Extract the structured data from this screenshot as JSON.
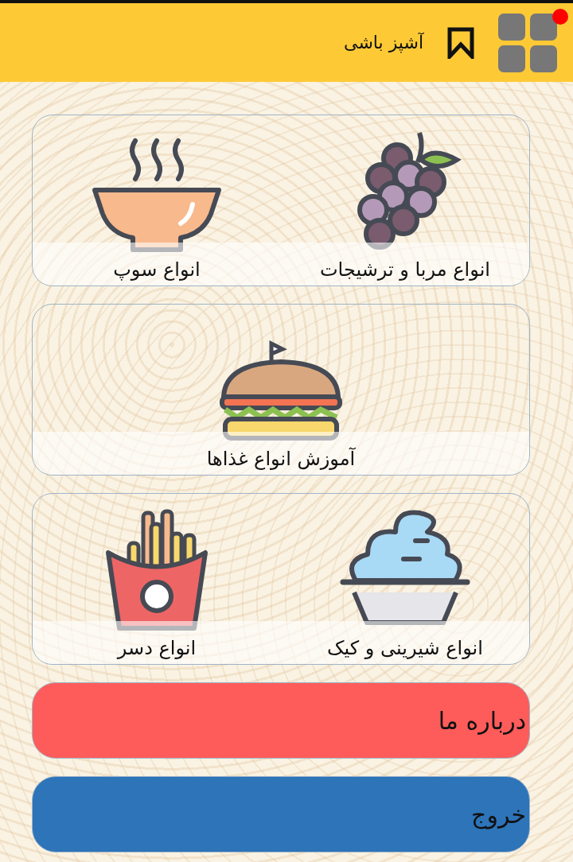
{
  "header": {
    "title": "آشپز باشی",
    "notification": true
  },
  "sections": [
    {
      "items": [
        {
          "label": "انواع مربا و ترشیجات",
          "kind": "grapes"
        },
        {
          "label": "انواع سوپ",
          "kind": "soup"
        }
      ]
    },
    {
      "items": [
        {
          "label": "آموزش انواع غذاها",
          "kind": "burger"
        }
      ]
    },
    {
      "items": [
        {
          "label": "انواع شیرینی و کیک",
          "kind": "icecream"
        },
        {
          "label": "انواع دسر",
          "kind": "fries"
        }
      ]
    }
  ],
  "buttons": [
    {
      "label": "درباره ما",
      "kind": "about"
    },
    {
      "label": "خروج",
      "kind": "exit"
    }
  ]
}
